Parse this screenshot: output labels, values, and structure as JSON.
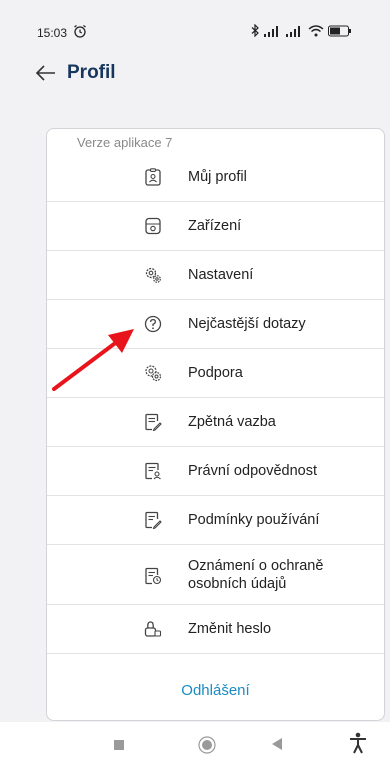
{
  "status": {
    "time": "15:03"
  },
  "header": {
    "title": "Profil"
  },
  "card": {
    "version_label": "Verze aplikace 7",
    "items": [
      {
        "label": "Můj profil",
        "icon": "id-badge-icon"
      },
      {
        "label": "Zařízení",
        "icon": "device-icon"
      },
      {
        "label": "Nastavení",
        "icon": "gears-icon"
      },
      {
        "label": "Nejčastější dotazy",
        "icon": "question-circle-icon"
      },
      {
        "label": "Podpora",
        "icon": "support-gears-icon"
      },
      {
        "label": "Zpětná vazba",
        "icon": "feedback-doc-icon"
      },
      {
        "label": "Právní odpovědnost",
        "icon": "legal-doc-icon"
      },
      {
        "label": "Podmínky používání",
        "icon": "terms-doc-icon"
      },
      {
        "label": "Oznámení o ochraně osobních údajů",
        "icon": "privacy-doc-icon"
      },
      {
        "label": "Změnit heslo",
        "icon": "lock-icon"
      }
    ],
    "logout_label": "Odhlášení"
  },
  "colors": {
    "title": "#17365d",
    "logout": "#1a8bc4",
    "annotation_arrow": "#e8141b"
  }
}
